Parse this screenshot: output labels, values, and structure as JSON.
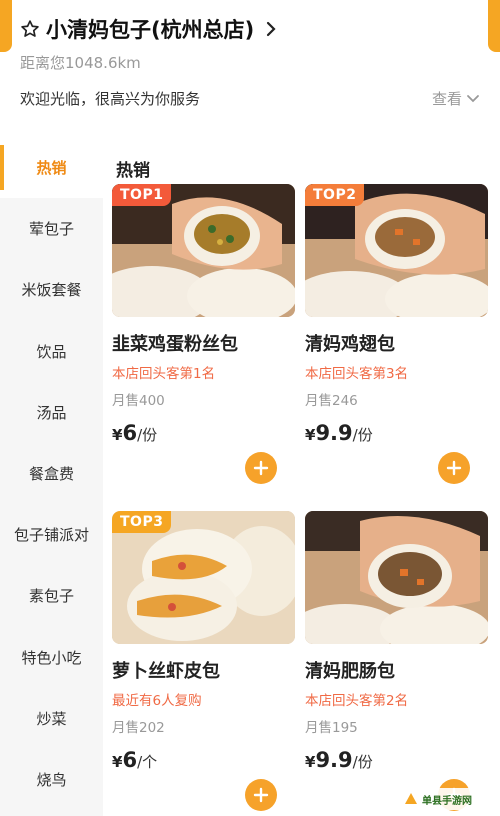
{
  "header": {
    "store_name": "小清妈包子(杭州总店)",
    "distance": "距离您1048.6km",
    "welcome": "欢迎光临，很高兴为你服务",
    "view_more": "查看"
  },
  "sidebar": {
    "items": [
      {
        "label": "热销",
        "active": true
      },
      {
        "label": "荤包子"
      },
      {
        "label": "米饭套餐"
      },
      {
        "label": "饮品"
      },
      {
        "label": "汤品"
      },
      {
        "label": "餐盒费"
      },
      {
        "label": "包子铺派对"
      },
      {
        "label": "素包子"
      },
      {
        "label": "特色小吃"
      },
      {
        "label": "炒菜"
      },
      {
        "label": "烧鸟"
      }
    ]
  },
  "section_title": "热销",
  "products": [
    {
      "badge": "TOP1",
      "name": "韭菜鸡蛋粉丝包",
      "rank": "本店回头客第1名",
      "sold": "月售400",
      "currency": "¥",
      "price": "6",
      "unit": "/份"
    },
    {
      "badge": "TOP2",
      "name": "清妈鸡翅包",
      "rank": "本店回头客第3名",
      "sold": "月售246",
      "currency": "¥",
      "price": "9.9",
      "unit": "/份"
    },
    {
      "badge": "TOP3",
      "name": "萝卜丝虾皮包",
      "rank": "最近有6人复购",
      "sold": "月售202",
      "currency": "¥",
      "price": "6",
      "unit": "/个"
    },
    {
      "badge": "",
      "name": "清妈肥肠包",
      "rank": "本店回头客第2名",
      "sold": "月售195",
      "currency": "¥",
      "price": "9.9",
      "unit": "/份"
    }
  ],
  "watermark": "单县手游网",
  "colors": {
    "accent": "#f5a623",
    "active_text": "#ef8a14",
    "rank_text": "#f06a45",
    "add_button": "#f6a22a"
  },
  "icons": {
    "title_icon": "star-outline-icon",
    "title_arrow": "chevron-right-icon",
    "view_more_arrow": "chevron-down-icon",
    "add": "plus-icon"
  }
}
